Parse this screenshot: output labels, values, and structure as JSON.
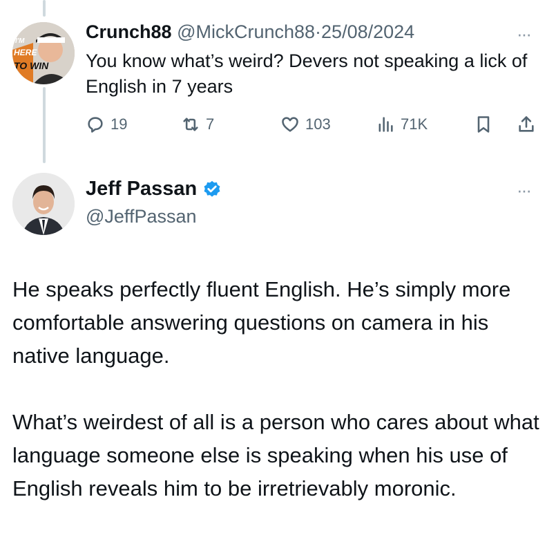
{
  "reply": {
    "display_name": "Crunch88",
    "handle": "@MickCrunch88",
    "separator": "·",
    "date": "25/08/2024",
    "avatar_text": "I'M HERE TO WIN",
    "text": "You know what’s weird? Devers not speaking a lick of English in 7 years",
    "stats": {
      "replies": "19",
      "reposts": "7",
      "likes": "103",
      "views": "71K"
    },
    "more_label": "···"
  },
  "main": {
    "display_name": "Jeff Passan",
    "handle": "@JeffPassan",
    "verified": true,
    "more_label": "···",
    "paragraphs": [
      "He speaks perfectly fluent English. He’s simply more comfortable answering questions on camera in his native language.",
      "What’s weirdest of all is a person who cares about what language someone else is speaking when his use of English reveals him to be irretrievably moronic."
    ]
  },
  "colors": {
    "text": "#0f1419",
    "secondary": "#536471",
    "verified": "#1d9bf0",
    "thread_line": "#cfd9de"
  },
  "icons": {
    "reply": "reply-icon",
    "repost": "repost-icon",
    "like": "heart-icon",
    "views": "views-icon",
    "bookmark": "bookmark-icon",
    "share": "share-icon"
  }
}
